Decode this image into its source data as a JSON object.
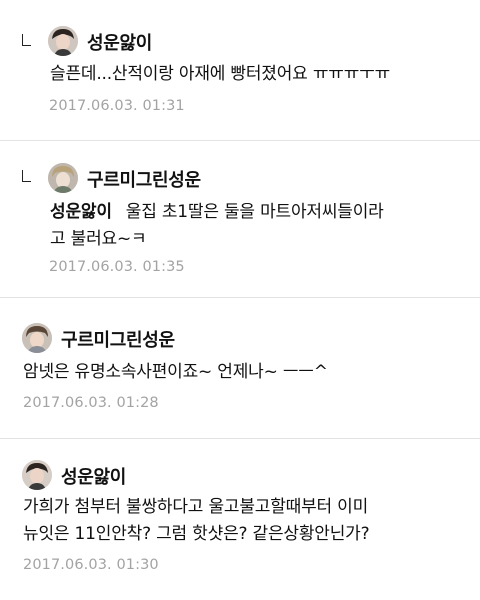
{
  "comments": [
    {
      "username": "성운앓이",
      "line1": "슬픈데...산적이랑 아재에 빵터졌어요 ㅠㅠㅠㅜㅠ",
      "timestamp": "2017.06.03. 01:31"
    },
    {
      "username": "구르미그린성운",
      "mention": "성운앓이",
      "line1": "울집 초1딸은 둘을 마트아저씨들이라",
      "line2": "고 불러요~ㅋ",
      "timestamp": "2017.06.03. 01:35"
    },
    {
      "username": "구르미그린성운",
      "line1": "암넷은 유명소속사편이죠~ 언제나~ ㅡㅡ^",
      "timestamp": "2017.06.03. 01:28"
    },
    {
      "username": "성운앓이",
      "line1": "가희가 첨부터 불쌍하다고 울고불고할때부터 이미",
      "line2": "뉴잇은 11인안착? 그럼 핫샷은? 같은상황안닌가?",
      "timestamp": "2017.06.03. 01:30"
    }
  ]
}
